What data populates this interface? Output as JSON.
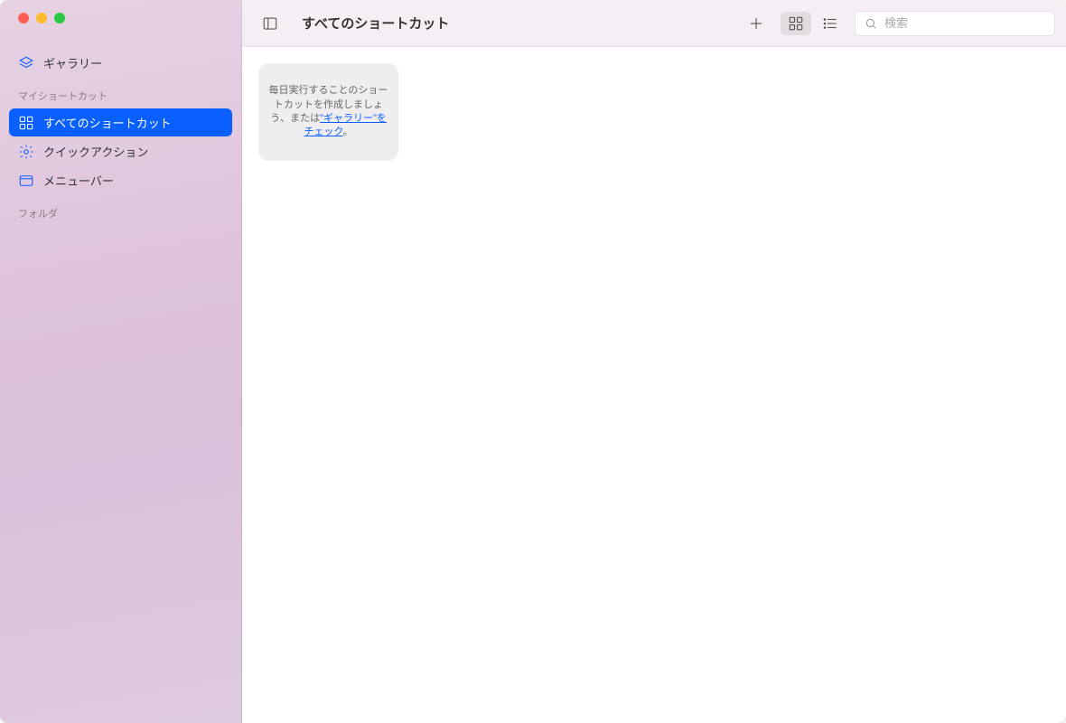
{
  "header": {
    "title": "すべてのショートカット"
  },
  "sidebar": {
    "gallery": "ギャラリー",
    "section_my": "マイショートカット",
    "section_folders": "フォルダ",
    "items": {
      "all": "すべてのショートカット",
      "quick": "クイックアクション",
      "menubar": "メニューバー"
    }
  },
  "search": {
    "placeholder": "検索"
  },
  "empty_card": {
    "text_before": "毎日実行することのショートカットを作成しましょう、または",
    "link_text": "\"ギャラリー\"をチェック",
    "text_after": "。"
  }
}
